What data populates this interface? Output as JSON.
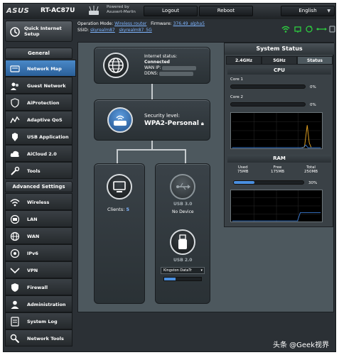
{
  "header": {
    "logo": "ASUS",
    "model": "RT-AC87U",
    "powered_by": [
      "Powered by",
      "Asuswrt-Merlin"
    ],
    "logout": "Logout",
    "reboot": "Reboot",
    "language": "English"
  },
  "quick_setup": "Quick Internet Setup",
  "info": {
    "operation_mode_label": "Operation Mode:",
    "operation_mode": "Wireless router",
    "firmware_label": "Firmware:",
    "firmware": "376.49_alpha5",
    "ssid_label": "SSID:",
    "ssid_1": "skyrealm87",
    "ssid_2": "skyrealm87_5G"
  },
  "menu": {
    "general_title": "General",
    "general_items": [
      {
        "label": "Network Map",
        "icon": "network-map-icon"
      },
      {
        "label": "Guest Network",
        "icon": "guest-network-icon"
      },
      {
        "label": "AiProtection",
        "icon": "aiprotection-icon"
      },
      {
        "label": "Adaptive QoS",
        "icon": "qos-icon"
      },
      {
        "label": "USB Application",
        "icon": "usb-app-icon"
      },
      {
        "label": "AiCloud 2.0",
        "icon": "aicloud-icon"
      },
      {
        "label": "Tools",
        "icon": "tools-icon"
      }
    ],
    "advanced_title": "Advanced Settings",
    "advanced_items": [
      {
        "label": "Wireless",
        "icon": "wireless-icon"
      },
      {
        "label": "LAN",
        "icon": "lan-icon"
      },
      {
        "label": "WAN",
        "icon": "wan-icon"
      },
      {
        "label": "IPv6",
        "icon": "ipv6-icon"
      },
      {
        "label": "VPN",
        "icon": "vpn-icon"
      },
      {
        "label": "Firewall",
        "icon": "firewall-icon"
      },
      {
        "label": "Administration",
        "icon": "administration-icon"
      },
      {
        "label": "System Log",
        "icon": "system-log-icon"
      },
      {
        "label": "Network Tools",
        "icon": "network-tools-icon"
      }
    ]
  },
  "network_map": {
    "internet_status_label": "Internet status:",
    "internet_status": "Connected",
    "wan_ip_label": "WAN IP:",
    "ddns_label": "DDNS:",
    "security_label": "Security level:",
    "security_value": "WPA2-Personal",
    "clients_label": "Clients:",
    "clients_count": "5",
    "usb_port_1": "USB 3.0",
    "usb_status": "No Device",
    "usb_port_2": "USB 2.0",
    "usb_device": "Kingston DataTr",
    "usb_usage": 0.3
  },
  "system_status": {
    "title": "System Status",
    "tabs": [
      "2.4GHz",
      "5GHz",
      "Status"
    ],
    "active_tab": "Status",
    "cpu_title": "CPU",
    "cores": [
      {
        "label": "Core 1",
        "percent": "0%"
      },
      {
        "label": "Core 2",
        "percent": "0%"
      }
    ],
    "ram_title": "RAM",
    "ram": {
      "used_label": "Used",
      "used": "75MB",
      "free_label": "Free",
      "free": "175MB",
      "total_label": "Total",
      "total": "250MB",
      "percent": "30%",
      "usage": 0.3
    }
  },
  "watermark": "头条 @Geek视界",
  "colors": {
    "accent": "#4a8fe0",
    "active_menu": "#3a78b8",
    "status_green": "#2ecc40"
  }
}
